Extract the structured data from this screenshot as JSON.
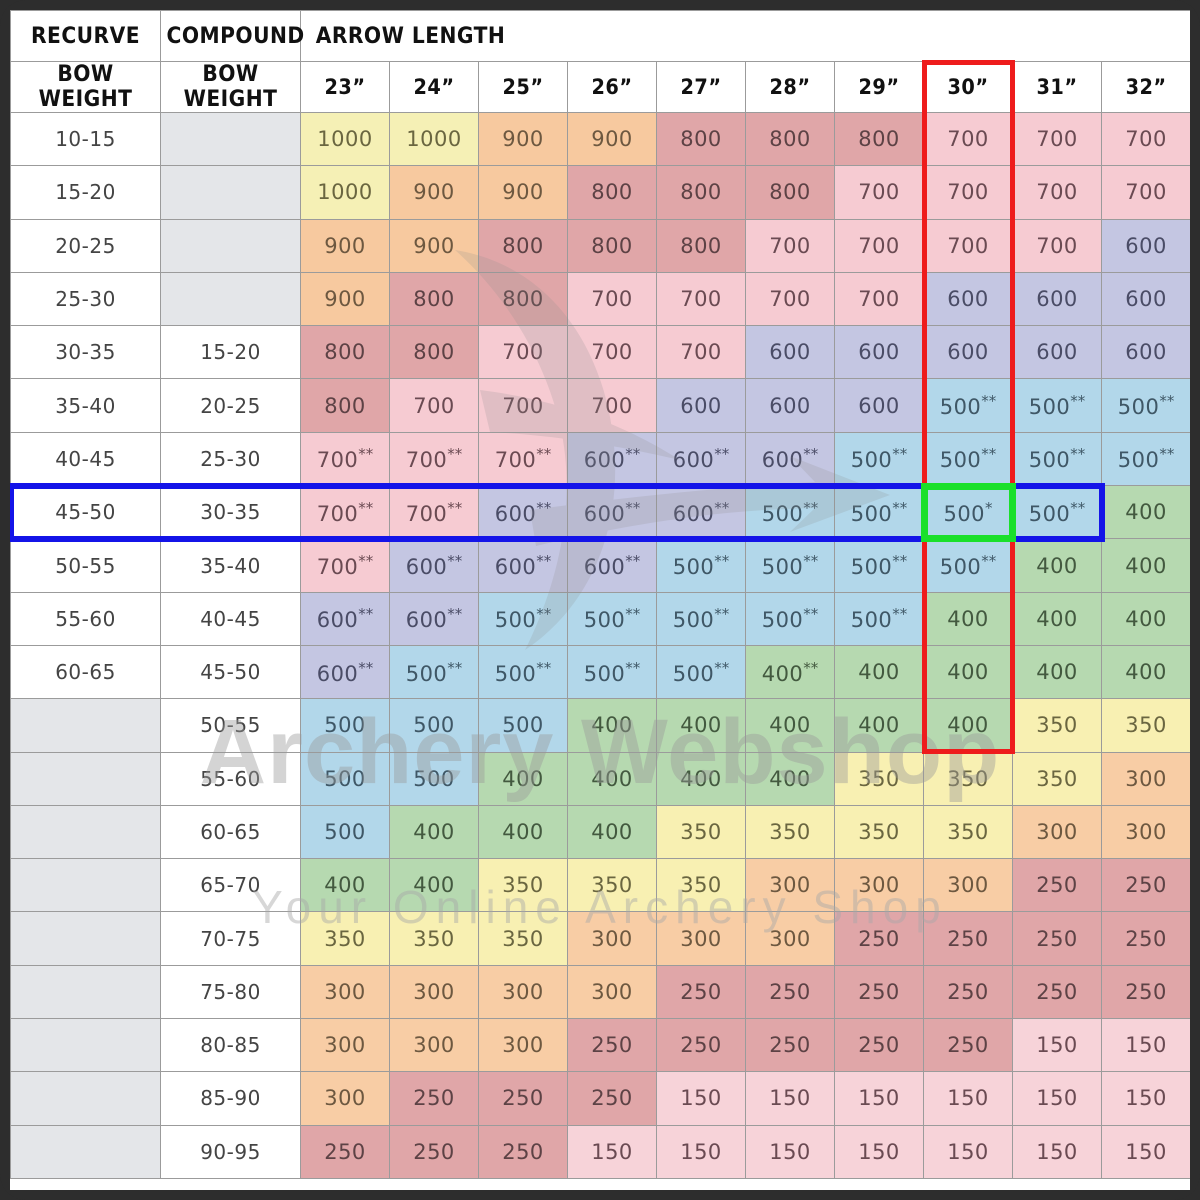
{
  "headers": {
    "recurve_title": "RECURVE",
    "compound_title": "COMPOUND",
    "arrow_length_title": "ARROW LENGTH",
    "recurve_sub": "BOW WEIGHT",
    "compound_sub": "BOW WEIGHT",
    "lengths": [
      "23”",
      "24”",
      "25”",
      "26”",
      "27”",
      "28”",
      "29”",
      "30”",
      "31”",
      "32”"
    ]
  },
  "watermark": {
    "line1": "Archery Webshop",
    "line2": "Your Online Archery Shop",
    "logo": "archery-webshop-logo"
  },
  "highlights": {
    "selected_column": "30”",
    "selected_row_recurve": "45-50",
    "selected_row_compound": "30-35",
    "selected_cell_value": "500*",
    "red": "#ee1c1c",
    "blue": "#1414e8",
    "green": "#1ae02a"
  },
  "legend_colors": {
    "1000": "#f5f0b5",
    "900": "#f7c99f",
    "800": "#e0a6a8",
    "700": "#f6cbd2",
    "600": "#c4c6e2",
    "500": "#b2d7ea",
    "400": "#b6d9b0",
    "350": "#f8f0b2",
    "300": "#f8cda5",
    "250": "#e0a6a8",
    "150": "#f7d3d9"
  },
  "chart_data": {
    "type": "table",
    "title": "Arrow Spine Selection Chart",
    "columns": [
      "RECURVE BOW WEIGHT",
      "COMPOUND BOW WEIGHT",
      "23”",
      "24”",
      "25”",
      "26”",
      "27”",
      "28”",
      "29”",
      "30”",
      "31”",
      "32”"
    ],
    "rows": [
      {
        "recurve": "10-15",
        "compound": "",
        "values": [
          "1000",
          "1000",
          "900",
          "900",
          "800",
          "800",
          "800",
          "700",
          "700",
          "700"
        ]
      },
      {
        "recurve": "15-20",
        "compound": "",
        "values": [
          "1000",
          "900",
          "900",
          "800",
          "800",
          "800",
          "700",
          "700",
          "700",
          "700"
        ]
      },
      {
        "recurve": "20-25",
        "compound": "",
        "values": [
          "900",
          "900",
          "800",
          "800",
          "800",
          "700",
          "700",
          "700",
          "700",
          "600"
        ]
      },
      {
        "recurve": "25-30",
        "compound": "",
        "values": [
          "900",
          "800",
          "800",
          "700",
          "700",
          "700",
          "700",
          "600",
          "600",
          "600"
        ]
      },
      {
        "recurve": "30-35",
        "compound": "15-20",
        "values": [
          "800",
          "800",
          "700",
          "700",
          "700",
          "600",
          "600",
          "600",
          "600",
          "600"
        ]
      },
      {
        "recurve": "35-40",
        "compound": "20-25",
        "values": [
          "800",
          "700",
          "700",
          "700",
          "600",
          "600",
          "600",
          "500**",
          "500**",
          "500**"
        ]
      },
      {
        "recurve": "40-45",
        "compound": "25-30",
        "values": [
          "700**",
          "700**",
          "700**",
          "600**",
          "600**",
          "600**",
          "500**",
          "500**",
          "500**",
          "500**"
        ]
      },
      {
        "recurve": "45-50",
        "compound": "30-35",
        "values": [
          "700**",
          "700**",
          "600**",
          "600**",
          "600**",
          "500**",
          "500**",
          "500*",
          "500**",
          "400"
        ]
      },
      {
        "recurve": "50-55",
        "compound": "35-40",
        "values": [
          "700**",
          "600**",
          "600**",
          "600**",
          "500**",
          "500**",
          "500**",
          "500**",
          "400",
          "400"
        ]
      },
      {
        "recurve": "55-60",
        "compound": "40-45",
        "values": [
          "600**",
          "600**",
          "500**",
          "500**",
          "500**",
          "500**",
          "500**",
          "400",
          "400",
          "400"
        ]
      },
      {
        "recurve": "60-65",
        "compound": "45-50",
        "values": [
          "600**",
          "500**",
          "500**",
          "500**",
          "500**",
          "400**",
          "400",
          "400",
          "400",
          "400"
        ]
      },
      {
        "recurve": "",
        "compound": "50-55",
        "values": [
          "500",
          "500",
          "500",
          "400",
          "400",
          "400",
          "400",
          "400",
          "350",
          "350"
        ]
      },
      {
        "recurve": "",
        "compound": "55-60",
        "values": [
          "500",
          "500",
          "400",
          "400",
          "400",
          "400",
          "350",
          "350",
          "350",
          "300"
        ]
      },
      {
        "recurve": "",
        "compound": "60-65",
        "values": [
          "500",
          "400",
          "400",
          "400",
          "350",
          "350",
          "350",
          "350",
          "300",
          "300"
        ]
      },
      {
        "recurve": "",
        "compound": "65-70",
        "values": [
          "400",
          "400",
          "350",
          "350",
          "350",
          "300",
          "300",
          "300",
          "250",
          "250"
        ]
      },
      {
        "recurve": "",
        "compound": "70-75",
        "values": [
          "350",
          "350",
          "350",
          "300",
          "300",
          "300",
          "250",
          "250",
          "250",
          "250"
        ]
      },
      {
        "recurve": "",
        "compound": "75-80",
        "values": [
          "300",
          "300",
          "300",
          "300",
          "250",
          "250",
          "250",
          "250",
          "250",
          "250"
        ]
      },
      {
        "recurve": "",
        "compound": "80-85",
        "values": [
          "300",
          "300",
          "300",
          "250",
          "250",
          "250",
          "250",
          "250",
          "150",
          "150"
        ]
      },
      {
        "recurve": "",
        "compound": "85-90",
        "values": [
          "300",
          "250",
          "250",
          "250",
          "150",
          "150",
          "150",
          "150",
          "150",
          "150"
        ]
      },
      {
        "recurve": "",
        "compound": "90-95",
        "values": [
          "250",
          "250",
          "250",
          "150",
          "150",
          "150",
          "150",
          "150",
          "150",
          "150"
        ]
      }
    ]
  }
}
